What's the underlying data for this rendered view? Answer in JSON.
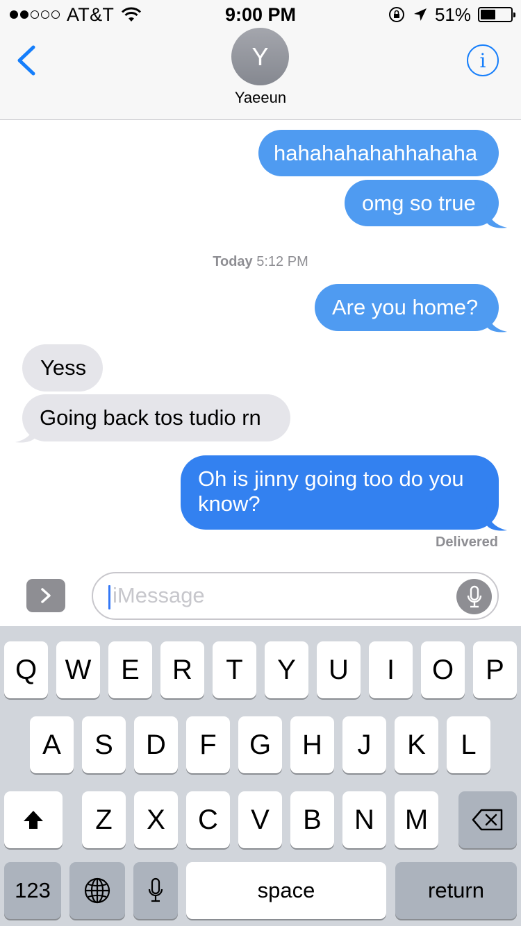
{
  "status_bar": {
    "carrier": "AT&T",
    "time": "9:00 PM",
    "battery_percent": "51%",
    "battery_level": 0.51,
    "signal_bars": 2
  },
  "nav": {
    "avatar_initial": "Y",
    "contact_name": "Yaeeun",
    "info_label": "i"
  },
  "messages": {
    "m1": "hahahahahahhahaha",
    "m2": "omg so true",
    "timestamp_day": "Today",
    "timestamp_time": "5:12 PM",
    "m3": "Are you home?",
    "m4": "Yess",
    "m5": "Going back tos tudio rn",
    "m6_line1": "Oh is jinny going too do you",
    "m6_line2": "know?",
    "delivered": "Delivered"
  },
  "input": {
    "placeholder": "iMessage"
  },
  "keyboard": {
    "row1": [
      "Q",
      "W",
      "E",
      "R",
      "T",
      "Y",
      "U",
      "I",
      "O",
      "P"
    ],
    "row2": [
      "A",
      "S",
      "D",
      "F",
      "G",
      "H",
      "J",
      "K",
      "L"
    ],
    "row3": [
      "Z",
      "X",
      "C",
      "V",
      "B",
      "N",
      "M"
    ],
    "numbers_label": "123",
    "space_label": "space",
    "return_label": "return"
  },
  "colors": {
    "sms_bubble": "#4f9bf1",
    "imessage_bubble": "#3381f0",
    "received_bubble": "#e5e5ea",
    "accent": "#157efb"
  }
}
